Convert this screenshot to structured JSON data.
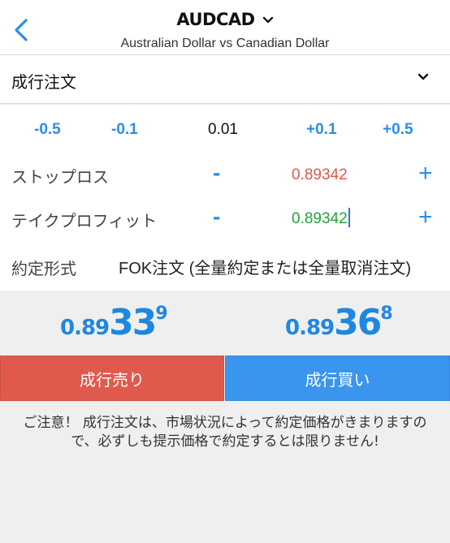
{
  "header": {
    "title": "AUDCAD",
    "subtitle": "Australian Dollar vs Canadian Dollar"
  },
  "order_type": {
    "label": "成行注文"
  },
  "steps": [
    "-0.5",
    "-0.1",
    "0.01",
    "+0.1",
    "+0.5"
  ],
  "stop_loss": {
    "label": "ストップロス",
    "minus": "-",
    "value": "0.89342",
    "plus": "+"
  },
  "take_profit": {
    "label": "テイクプロフィット",
    "minus": "-",
    "value": "0.89342",
    "plus": "+"
  },
  "fill_policy": {
    "label": "約定形式",
    "value": "FOK注文 (全量約定または全量取消注文)"
  },
  "sell_price": {
    "prefix": "0.89",
    "main": "33",
    "sup": "9"
  },
  "buy_price": {
    "prefix": "0.89",
    "main": "36",
    "sup": "8"
  },
  "buttons": {
    "sell": "成行売り",
    "buy": "成行買い"
  },
  "notice": "ご注意！ 成行注文は、市場状況によって約定価格がきまりますので、必ずしも提示価格で約定するとは限りません!",
  "colors": {
    "accent": "#2a8ee8",
    "sell": "#df5a4d",
    "buy": "#3a95ee",
    "stop_loss_value": "#e0564b",
    "take_profit_value": "#1fa33a"
  }
}
